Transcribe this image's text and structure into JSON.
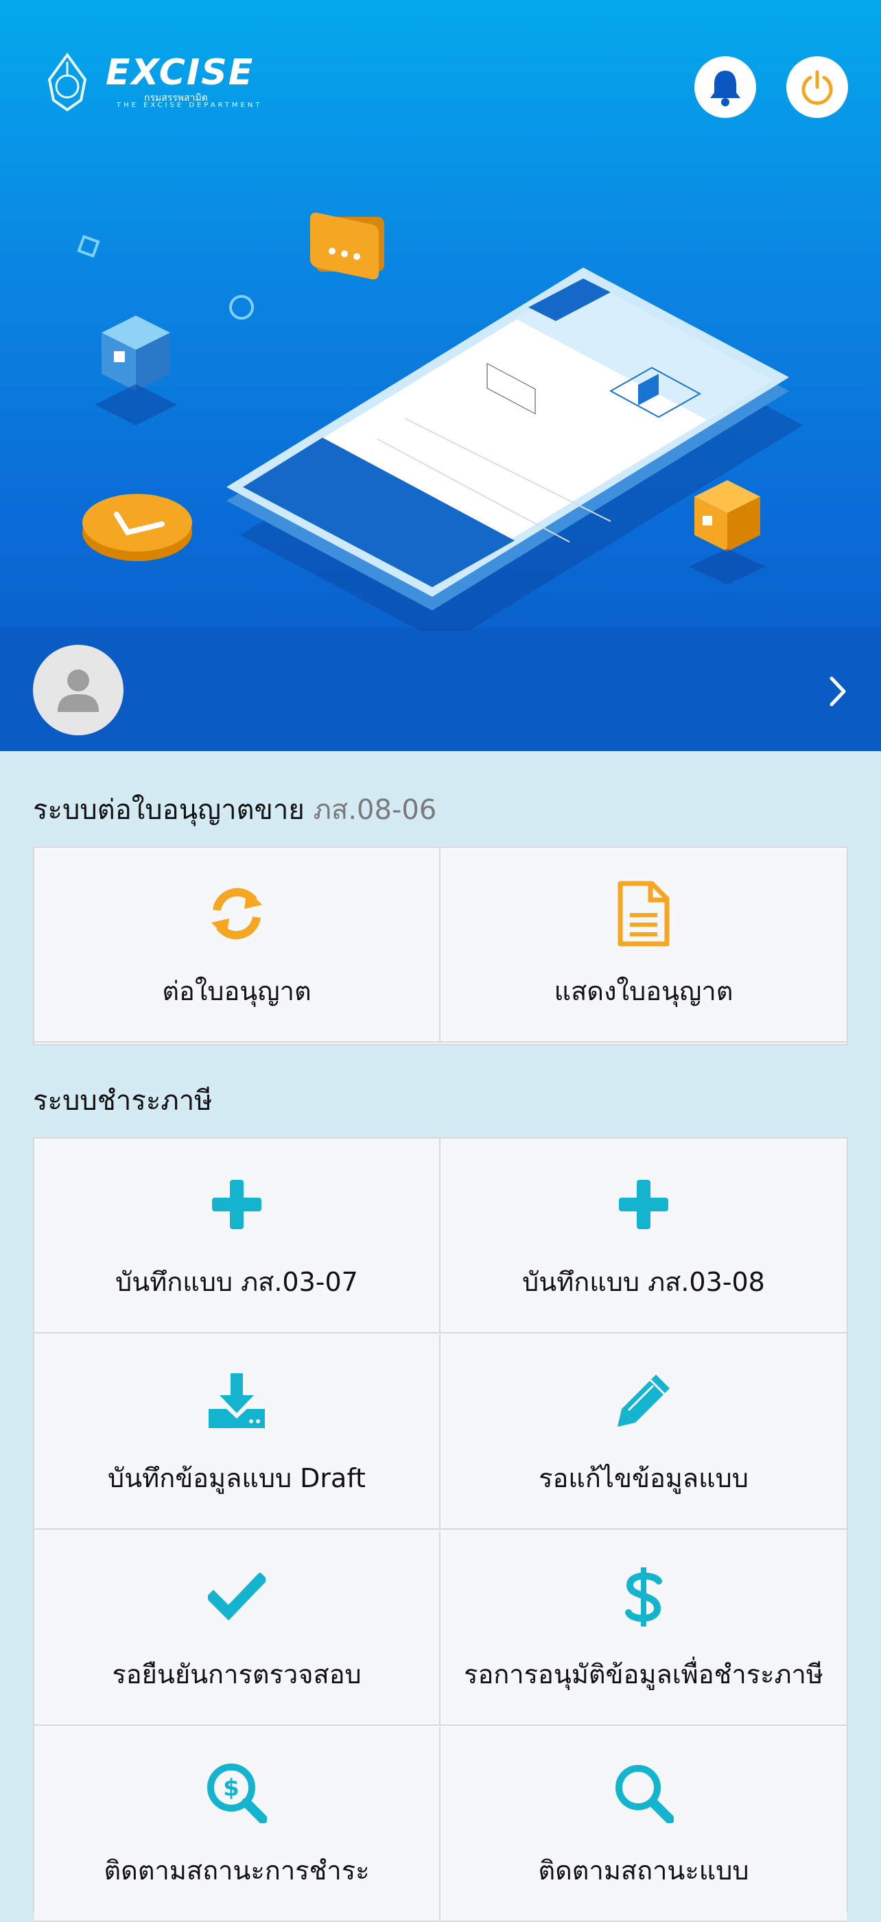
{
  "header": {
    "logo_text": "EXCISE",
    "logo_sub_th": "กรมสรรพสามิต",
    "logo_sub_en": "THE EXCISE DEPARTMENT"
  },
  "icons": {
    "bell": "bell-icon",
    "power": "power-icon",
    "avatar": "user-avatar-icon",
    "next": "chevron-right-icon"
  },
  "colors": {
    "hero_top": "#04a8ec",
    "hero_bottom": "#0b58c4",
    "bell": "#0a57c2",
    "power": "#f5a623",
    "accent_orange": "#f5a623",
    "accent_teal": "#14b4cf",
    "page_bg": "#d4ebf4"
  },
  "license_section": {
    "title": "ระบบต่อใบอนุญาตขาย",
    "code": "ภส.08-06",
    "items": [
      {
        "label": "ต่อใบอนุญาต",
        "icon": "refresh-icon"
      },
      {
        "label": "แสดงใบอนุญาต",
        "icon": "document-icon"
      }
    ]
  },
  "tax_section": {
    "title": "ระบบชำระภาษี",
    "items": [
      {
        "label": "บันทึกแบบ ภส.03-07",
        "icon": "plus-icon"
      },
      {
        "label": "บันทึกแบบ ภส.03-08",
        "icon": "plus-icon"
      },
      {
        "label": "บันทึกข้อมูลแบบ Draft",
        "icon": "download-icon"
      },
      {
        "label": "รอแก้ไขข้อมูลแบบ",
        "icon": "pencil-icon"
      },
      {
        "label": "รอยืนยันการตรวจสอบ",
        "icon": "check-icon"
      },
      {
        "label": "รอการอนุมัติข้อมูลเพื่อชำระภาษี",
        "icon": "dollar-icon"
      },
      {
        "label": "ติดตามสถานะการชำระ",
        "icon": "search-dollar-icon"
      },
      {
        "label": "ติดตามสถานะแบบ",
        "icon": "search-icon"
      }
    ]
  }
}
